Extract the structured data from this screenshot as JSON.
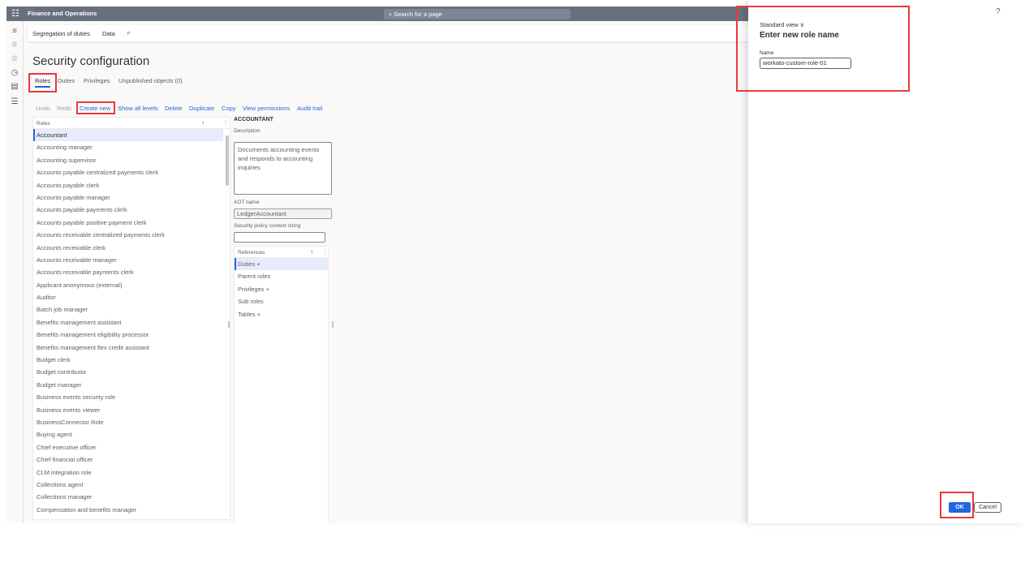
{
  "app": {
    "title": "Finance and Operations",
    "search_placeholder": "Search for a page",
    "help_label": "?"
  },
  "leftnav": {
    "icons": [
      "hamburger-icon",
      "home-icon",
      "star-icon",
      "clock-icon",
      "workspace-icon",
      "list-icon"
    ]
  },
  "actionbar": {
    "items": [
      "Segregation of duties",
      "Data"
    ]
  },
  "page": {
    "title": "Security configuration",
    "tabs": [
      {
        "label": "Roles",
        "active": true
      },
      {
        "label": "Duties",
        "active": false
      },
      {
        "label": "Privileges",
        "active": false
      },
      {
        "label": "Unpublished objects (0)",
        "active": false
      }
    ],
    "toolbar": [
      {
        "label": "Undo",
        "enabled": false
      },
      {
        "label": "Redo",
        "enabled": false
      },
      {
        "label": "Create new",
        "enabled": true
      },
      {
        "label": "Show all levels",
        "enabled": true
      },
      {
        "label": "Delete",
        "enabled": true
      },
      {
        "label": "Duplicate",
        "enabled": true
      },
      {
        "label": "Copy",
        "enabled": true
      },
      {
        "label": "View permissions",
        "enabled": true
      },
      {
        "label": "Audit trail",
        "enabled": true
      }
    ]
  },
  "roles_grid": {
    "header": "Roles",
    "selected": "Accountant",
    "rows": [
      "Accountant",
      "Accounting manager",
      "Accounting supervisor",
      "Accounts payable centralized payments clerk",
      "Accounts payable clerk",
      "Accounts payable manager",
      "Accounts payable payments clerk",
      "Accounts payable positive payment clerk",
      "Accounts receivable centralized payments clerk",
      "Accounts receivable clerk",
      "Accounts receivable manager",
      "Accounts receivable payments clerk",
      "Applicant anonymous (external)",
      "Auditor",
      "Batch job manager",
      "Benefits management assistant",
      "Benefits management eligibility processor",
      "Benefits management flex credit assistant",
      "Budget clerk",
      "Budget contributor",
      "Budget manager",
      "Business events security role",
      "Business events viewer",
      "BusinessConnector Role",
      "Buying agent",
      "Chief executive officer",
      "Chief financial officer",
      "CLM integration role",
      "Collections agent",
      "Collections manager",
      "Compensation and benefits manager"
    ]
  },
  "details": {
    "title": "ACCOUNTANT",
    "description_label": "Description",
    "description": "Documents accounting events and responds to accounting inquiries",
    "aot_label": "AOT name",
    "aot_value": "LedgerAccountant",
    "context_label": "Security policy context string",
    "context_value": "",
    "references_header": "References",
    "references": [
      "Duties +",
      "Parent roles",
      "Privileges +",
      "Sub roles",
      "Tables +"
    ],
    "references_selected": "Duties +"
  },
  "dialog": {
    "view_label": "Standard view",
    "title": "Enter new role name",
    "name_label": "Name",
    "name_value": "workato-custom-role-01",
    "ok_label": "OK",
    "cancel_label": "Cancel"
  },
  "colors": {
    "accent": "#2266e3",
    "topbar": "#69707d",
    "highlight": "#e8393d"
  }
}
